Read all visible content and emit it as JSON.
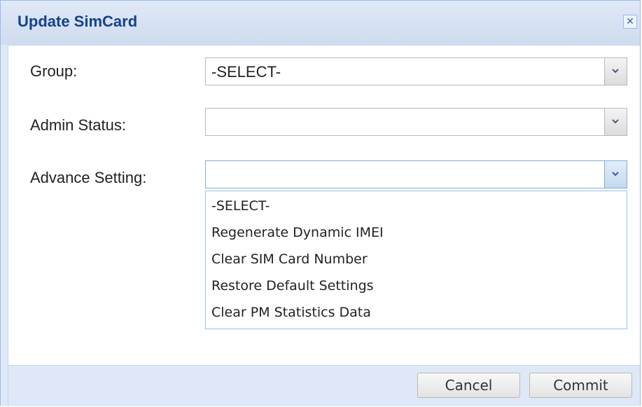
{
  "dialog": {
    "title": "Update SimCard",
    "close_symbol": "✕"
  },
  "form": {
    "group_label": "Group:",
    "group_value": "-SELECT-",
    "admin_status_label": "Admin Status:",
    "admin_status_value": "",
    "advance_setting_label": "Advance Setting:",
    "advance_setting_value": ""
  },
  "dropdown": {
    "options": [
      "-SELECT-",
      "Regenerate Dynamic IMEI",
      "Clear SIM Card Number",
      "Restore Default Settings",
      "Clear PM Statistics Data"
    ]
  },
  "footer": {
    "cancel_label": "Cancel",
    "commit_label": "Commit"
  },
  "colors": {
    "title": "#15428b",
    "panel_bg": "#dfe8f6",
    "border": "#99bbe8"
  },
  "icons": {
    "close": "close-icon",
    "dropdown": "chevron-down-icon"
  }
}
